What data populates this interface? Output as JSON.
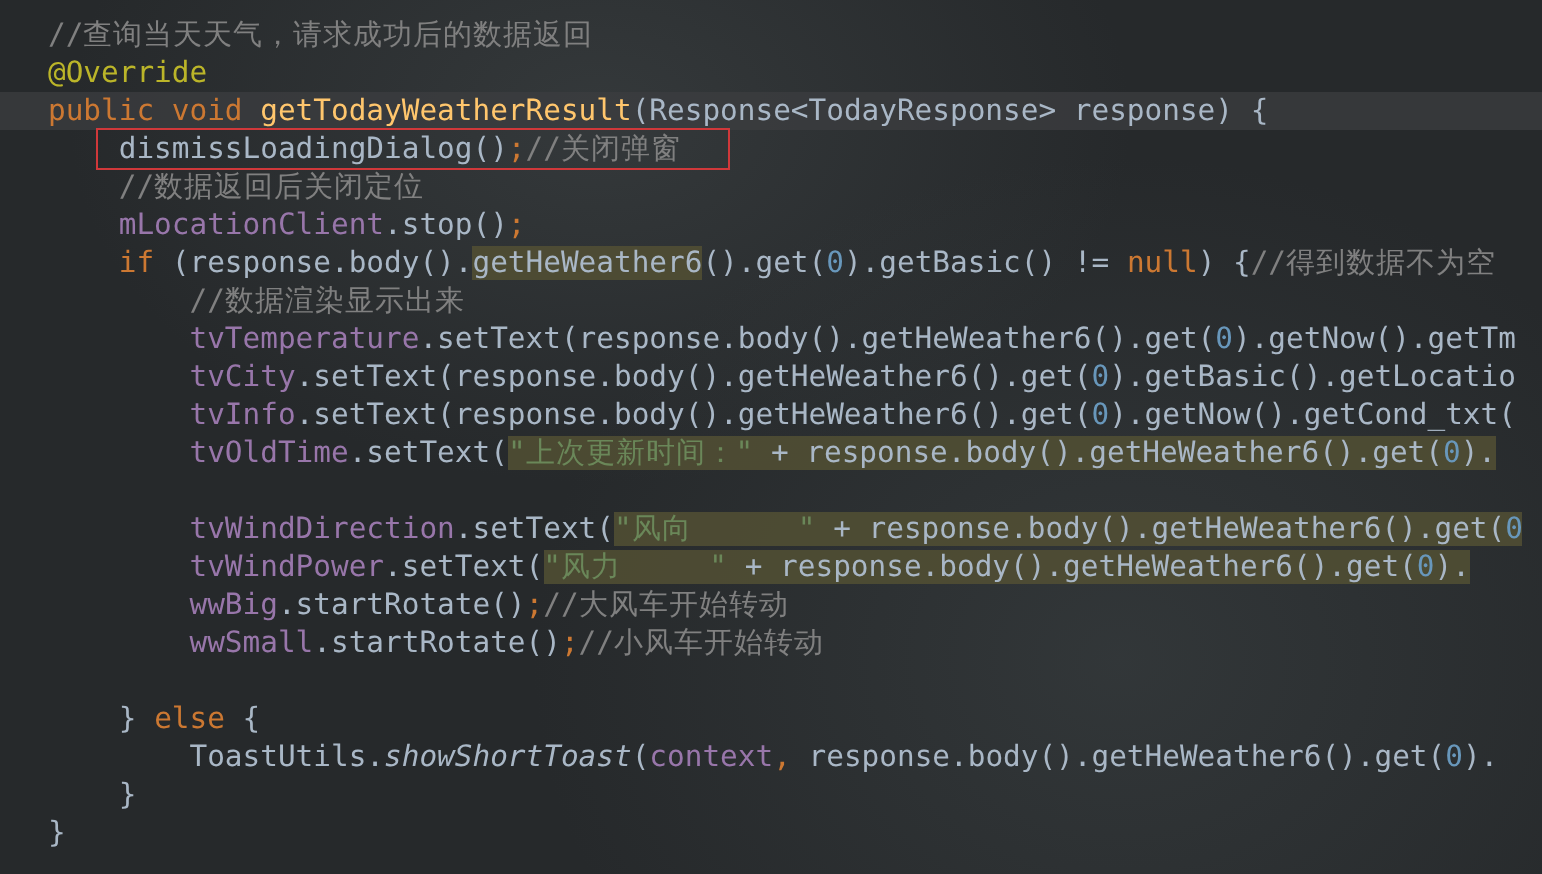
{
  "editor": {
    "lines": [
      {
        "kind": "code",
        "current": false,
        "boxed": false,
        "tokens": [
          {
            "text": "//查询当天天气，请求成功后的数据返回",
            "kind": "comment",
            "marked": false
          }
        ]
      },
      {
        "kind": "code",
        "current": false,
        "boxed": false,
        "tokens": [
          {
            "text": "@Override",
            "kind": "annotation",
            "marked": false
          }
        ]
      },
      {
        "kind": "code",
        "current": true,
        "boxed": false,
        "tokens": [
          {
            "text": "public void ",
            "kind": "keyword",
            "marked": false
          },
          {
            "text": "getTodayWeatherResult",
            "kind": "method",
            "marked": false
          },
          {
            "text": "(Response<TodayResponse> response) {",
            "kind": "plain",
            "marked": false
          }
        ]
      },
      {
        "kind": "code",
        "current": false,
        "boxed": true,
        "tokens": [
          {
            "text": "    dismissLoadingDialog()",
            "kind": "plain",
            "marked": false
          },
          {
            "text": ";",
            "kind": "keyword",
            "marked": false
          },
          {
            "text": "//关闭弹窗",
            "kind": "comment",
            "marked": false
          }
        ]
      },
      {
        "kind": "code",
        "current": false,
        "boxed": false,
        "tokens": [
          {
            "text": "    //数据返回后关闭定位",
            "kind": "comment",
            "marked": false
          }
        ]
      },
      {
        "kind": "code",
        "current": false,
        "boxed": false,
        "tokens": [
          {
            "text": "    mLocationClient",
            "kind": "field",
            "marked": false
          },
          {
            "text": ".stop()",
            "kind": "plain",
            "marked": false
          },
          {
            "text": ";",
            "kind": "keyword",
            "marked": false
          }
        ]
      },
      {
        "kind": "code",
        "current": false,
        "boxed": false,
        "tokens": [
          {
            "text": "    if ",
            "kind": "keyword",
            "marked": false
          },
          {
            "text": "(response.body().",
            "kind": "plain",
            "marked": false
          },
          {
            "text": "getHeWeather6",
            "kind": "plain",
            "marked": true
          },
          {
            "text": "().get(",
            "kind": "plain",
            "marked": false
          },
          {
            "text": "0",
            "kind": "number",
            "marked": false
          },
          {
            "text": ").getBasic() != ",
            "kind": "plain",
            "marked": false
          },
          {
            "text": "null",
            "kind": "keyword",
            "marked": false
          },
          {
            "text": ") {",
            "kind": "plain",
            "marked": false
          },
          {
            "text": "//得到数据不为空",
            "kind": "comment",
            "marked": false
          }
        ]
      },
      {
        "kind": "code",
        "current": false,
        "boxed": false,
        "tokens": [
          {
            "text": "        //数据渲染显示出来",
            "kind": "comment",
            "marked": false
          }
        ]
      },
      {
        "kind": "code",
        "current": false,
        "boxed": false,
        "tokens": [
          {
            "text": "        tvTemperature",
            "kind": "field",
            "marked": false
          },
          {
            "text": ".setText(response.body().getHeWeather6().get(",
            "kind": "plain",
            "marked": false
          },
          {
            "text": "0",
            "kind": "number",
            "marked": false
          },
          {
            "text": ").getNow().getTm",
            "kind": "plain",
            "marked": false
          }
        ]
      },
      {
        "kind": "code",
        "current": false,
        "boxed": false,
        "tokens": [
          {
            "text": "        tvCity",
            "kind": "field",
            "marked": false
          },
          {
            "text": ".setText(response.body().getHeWeather6().get(",
            "kind": "plain",
            "marked": false
          },
          {
            "text": "0",
            "kind": "number",
            "marked": false
          },
          {
            "text": ").getBasic().getLocatio",
            "kind": "plain",
            "marked": false
          }
        ]
      },
      {
        "kind": "code",
        "current": false,
        "boxed": false,
        "tokens": [
          {
            "text": "        tvInfo",
            "kind": "field",
            "marked": false
          },
          {
            "text": ".setText(response.body().getHeWeather6().get(",
            "kind": "plain",
            "marked": false
          },
          {
            "text": "0",
            "kind": "number",
            "marked": false
          },
          {
            "text": ").getNow().getCond_txt(",
            "kind": "plain",
            "marked": false
          }
        ]
      },
      {
        "kind": "code",
        "current": false,
        "boxed": false,
        "tokens": [
          {
            "text": "        tvOldTime",
            "kind": "field",
            "marked": false
          },
          {
            "text": ".setText(",
            "kind": "plain",
            "marked": false
          },
          {
            "text": "\"上次更新时间：\"",
            "kind": "string",
            "marked": true
          },
          {
            "text": " + response.body().getHeWeather6().get(",
            "kind": "plain",
            "marked": true
          },
          {
            "text": "0",
            "kind": "number",
            "marked": true
          },
          {
            "text": ").",
            "kind": "plain",
            "marked": true
          }
        ]
      },
      {
        "kind": "blank"
      },
      {
        "kind": "code",
        "current": false,
        "boxed": false,
        "tokens": [
          {
            "text": "        tvWindDirection",
            "kind": "field",
            "marked": false
          },
          {
            "text": ".setText(",
            "kind": "plain",
            "marked": false
          },
          {
            "text": "\"风向      \"",
            "kind": "string",
            "marked": true
          },
          {
            "text": " + response.body().getHeWeather6().get(",
            "kind": "plain",
            "marked": true
          },
          {
            "text": "0",
            "kind": "number",
            "marked": true
          }
        ]
      },
      {
        "kind": "code",
        "current": false,
        "boxed": false,
        "tokens": [
          {
            "text": "        tvWindPower",
            "kind": "field",
            "marked": false
          },
          {
            "text": ".setText(",
            "kind": "plain",
            "marked": false
          },
          {
            "text": "\"风力     \"",
            "kind": "string",
            "marked": true
          },
          {
            "text": " + response.body().getHeWeather6().get(",
            "kind": "plain",
            "marked": true
          },
          {
            "text": "0",
            "kind": "number",
            "marked": true
          },
          {
            "text": ").",
            "kind": "plain",
            "marked": true
          }
        ]
      },
      {
        "kind": "code",
        "current": false,
        "boxed": false,
        "tokens": [
          {
            "text": "        wwBig",
            "kind": "field",
            "marked": false
          },
          {
            "text": ".startRotate()",
            "kind": "plain",
            "marked": false
          },
          {
            "text": ";",
            "kind": "keyword",
            "marked": false
          },
          {
            "text": "//大风车开始转动",
            "kind": "comment",
            "marked": false
          }
        ]
      },
      {
        "kind": "code",
        "current": false,
        "boxed": false,
        "tokens": [
          {
            "text": "        wwSmall",
            "kind": "field",
            "marked": false
          },
          {
            "text": ".startRotate()",
            "kind": "plain",
            "marked": false
          },
          {
            "text": ";",
            "kind": "keyword",
            "marked": false
          },
          {
            "text": "//小风车开始转动",
            "kind": "comment",
            "marked": false
          }
        ]
      },
      {
        "kind": "blank"
      },
      {
        "kind": "code",
        "current": false,
        "boxed": false,
        "tokens": [
          {
            "text": "    } ",
            "kind": "plain",
            "marked": false
          },
          {
            "text": "else",
            "kind": "keyword",
            "marked": false
          },
          {
            "text": " {",
            "kind": "plain",
            "marked": false
          }
        ]
      },
      {
        "kind": "code",
        "current": false,
        "boxed": false,
        "tokens": [
          {
            "text": "        ToastUtils.",
            "kind": "plain",
            "marked": false
          },
          {
            "text": "showShortToast",
            "kind": "italic",
            "marked": false
          },
          {
            "text": "(",
            "kind": "plain",
            "marked": false
          },
          {
            "text": "context",
            "kind": "field",
            "marked": false
          },
          {
            "text": ",",
            "kind": "keyword",
            "marked": false
          },
          {
            "text": " response.body().getHeWeather6().get(",
            "kind": "plain",
            "marked": false
          },
          {
            "text": "0",
            "kind": "number",
            "marked": false
          },
          {
            "text": ").",
            "kind": "plain",
            "marked": false
          }
        ]
      },
      {
        "kind": "code",
        "current": false,
        "boxed": false,
        "tokens": [
          {
            "text": "    }",
            "kind": "plain",
            "marked": false
          }
        ]
      },
      {
        "kind": "code",
        "current": false,
        "boxed": false,
        "tokens": [
          {
            "text": "}",
            "kind": "plain",
            "marked": false
          }
        ]
      }
    ]
  }
}
